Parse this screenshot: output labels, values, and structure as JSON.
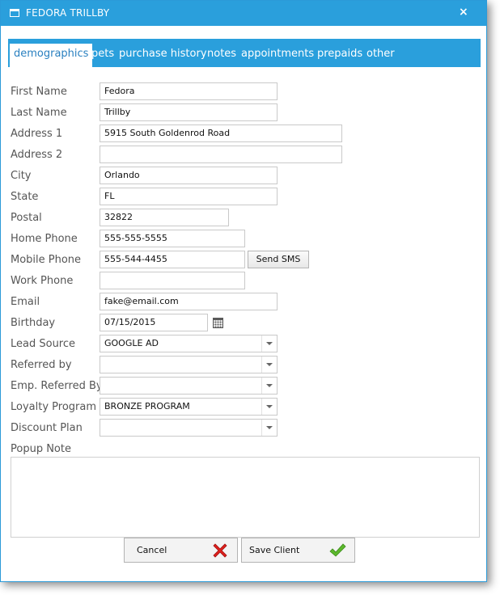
{
  "window": {
    "title": "FEDORA TRILLBY",
    "close_label": "×"
  },
  "tabs": [
    {
      "label": "demographics",
      "active": true
    },
    {
      "label": "pets",
      "active": false
    },
    {
      "label": "purchase history",
      "active": false
    },
    {
      "label": "notes",
      "active": false
    },
    {
      "label": "appointments",
      "active": false
    },
    {
      "label": "prepaids",
      "active": false
    },
    {
      "label": "other",
      "active": false
    }
  ],
  "form": {
    "first_name": {
      "label": "First Name",
      "value": "Fedora"
    },
    "last_name": {
      "label": "Last Name",
      "value": "Trillby"
    },
    "address1": {
      "label": "Address 1",
      "value": "5915 South Goldenrod Road"
    },
    "address2": {
      "label": "Address 2",
      "value": ""
    },
    "city": {
      "label": "City",
      "value": "Orlando"
    },
    "state": {
      "label": "State",
      "value": "FL"
    },
    "postal": {
      "label": "Postal",
      "value": "32822"
    },
    "home_phone": {
      "label": "Home Phone",
      "value": "555-555-5555"
    },
    "mobile_phone": {
      "label": "Mobile Phone",
      "value": "555-544-4455"
    },
    "send_sms_label": "Send SMS",
    "work_phone": {
      "label": "Work Phone",
      "value": ""
    },
    "email": {
      "label": "Email",
      "value": "fake@email.com"
    },
    "birthday": {
      "label": "Birthday",
      "value": "07/15/2015"
    },
    "lead_source": {
      "label": "Lead Source",
      "value": "GOOGLE AD"
    },
    "referred_by": {
      "label": "Referred by",
      "value": ""
    },
    "emp_referred_by": {
      "label": "Emp. Referred By",
      "value": ""
    },
    "loyalty_program": {
      "label": "Loyalty Program",
      "value": "BRONZE PROGRAM"
    },
    "discount_plan": {
      "label": "Discount Plan",
      "value": ""
    },
    "popup_note": {
      "label": "Popup Note",
      "value": ""
    }
  },
  "buttons": {
    "cancel": "Cancel",
    "save": "Save Client"
  },
  "colors": {
    "accent": "#2a9fdc",
    "cancel_icon": "#e0201c",
    "save_icon": "#5cb82c"
  },
  "icons": {
    "window": "window-icon",
    "calendar": "calendar-icon",
    "cancel": "red-x-icon",
    "save": "green-check-icon"
  }
}
